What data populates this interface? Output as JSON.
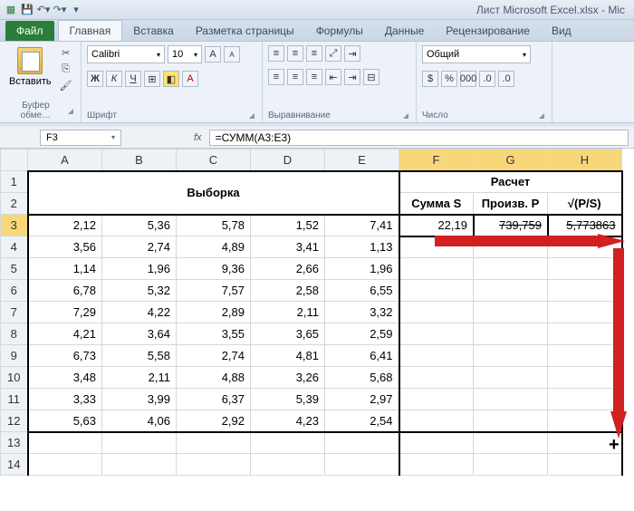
{
  "titlebar": {
    "filename": "Лист Microsoft Excel.xlsx - Mic"
  },
  "tabs": {
    "file": "Файл",
    "home": "Главная",
    "insert": "Вставка",
    "layout": "Разметка страницы",
    "formulas": "Формулы",
    "data": "Данные",
    "review": "Рецензирование",
    "view": "Вид"
  },
  "ribbon": {
    "clipboard": {
      "paste": "Вставить",
      "label": "Буфер обме…"
    },
    "font": {
      "name": "Calibri",
      "size": "10",
      "label": "Шрифт"
    },
    "align": {
      "label": "Выравнивание"
    },
    "number": {
      "fmt": "Общий",
      "label": "Число"
    }
  },
  "namebox": "F3",
  "fx": "fx",
  "formula": "=СУММ(A3:E3)",
  "cols": [
    "A",
    "B",
    "C",
    "D",
    "E",
    "F",
    "G",
    "H"
  ],
  "headers": {
    "sample": "Выборка",
    "calc": "Расчет",
    "sumS": "Сумма S",
    "prodP": "Произв. P",
    "rootPS": "√(P/S)"
  },
  "rows": [
    {
      "r": 3,
      "v": [
        "2,12",
        "5,36",
        "5,78",
        "1,52",
        "7,41",
        "22,19",
        "739,759",
        "5,773863"
      ]
    },
    {
      "r": 4,
      "v": [
        "3,56",
        "2,74",
        "4,89",
        "3,41",
        "1,13",
        "",
        "",
        ""
      ]
    },
    {
      "r": 5,
      "v": [
        "1,14",
        "1,96",
        "9,36",
        "2,66",
        "1,96",
        "",
        "",
        ""
      ]
    },
    {
      "r": 6,
      "v": [
        "6,78",
        "5,32",
        "7,57",
        "2,58",
        "6,55",
        "",
        "",
        ""
      ]
    },
    {
      "r": 7,
      "v": [
        "7,29",
        "4,22",
        "2,89",
        "2,11",
        "3,32",
        "",
        "",
        ""
      ]
    },
    {
      "r": 8,
      "v": [
        "4,21",
        "3,64",
        "3,55",
        "3,65",
        "2,59",
        "",
        "",
        ""
      ]
    },
    {
      "r": 9,
      "v": [
        "6,73",
        "5,58",
        "2,74",
        "4,81",
        "6,41",
        "",
        "",
        ""
      ]
    },
    {
      "r": 10,
      "v": [
        "3,48",
        "2,11",
        "4,88",
        "3,26",
        "5,68",
        "",
        "",
        ""
      ]
    },
    {
      "r": 11,
      "v": [
        "3,33",
        "3,99",
        "6,37",
        "5,39",
        "2,97",
        "",
        "",
        ""
      ]
    },
    {
      "r": 12,
      "v": [
        "5,63",
        "4,06",
        "2,92",
        "4,23",
        "2,54",
        "",
        "",
        ""
      ]
    },
    {
      "r": 13,
      "v": [
        "",
        "",
        "",
        "",
        "",
        "",
        "",
        ""
      ]
    },
    {
      "r": 14,
      "v": [
        "",
        "",
        "",
        "",
        "",
        "",
        "",
        ""
      ]
    }
  ]
}
